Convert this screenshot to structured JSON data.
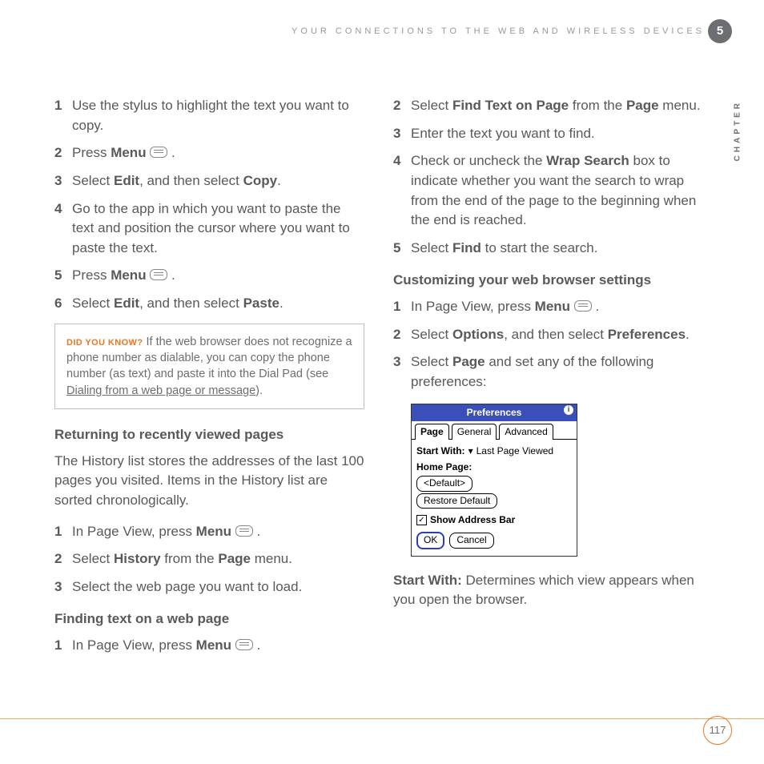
{
  "header": {
    "running_head": "YOUR CONNECTIONS TO THE WEB AND WIRELESS DEVICES",
    "chapter_number": "5",
    "chapter_label": "CHAPTER",
    "page_number": "117"
  },
  "left": {
    "steps_a": [
      {
        "n": "1",
        "pre": "Use the stylus to highlight the text you want to copy."
      },
      {
        "n": "2",
        "pre": "Press ",
        "bold": "Menu",
        "icon": true,
        "post": " ."
      },
      {
        "n": "3",
        "pre": "Select ",
        "bold": "Edit",
        "post": ", and then select ",
        "bold2": "Copy",
        "post2": "."
      },
      {
        "n": "4",
        "pre": "Go to the app in which you want to paste the text and position the cursor where you want to paste the text."
      },
      {
        "n": "5",
        "pre": "Press ",
        "bold": "Menu",
        "icon": true,
        "post": " ."
      },
      {
        "n": "6",
        "pre": "Select ",
        "bold": "Edit",
        "post": ", and then select ",
        "bold2": "Paste",
        "post2": "."
      }
    ],
    "tip": {
      "lead": "DID YOU KNOW?",
      "body_before": " If the web browser does not recognize a phone number as dialable, you can copy the phone number (as text) and paste it into the Dial Pad (see ",
      "link": "Dialing from a web page or message",
      "body_after": ")."
    },
    "heading_b": "Returning to recently viewed pages",
    "para_b": "The History list stores the addresses of the last 100 pages you visited. Items in the History list are sorted chronologically.",
    "steps_b": [
      {
        "n": "1",
        "pre": "In Page View, press ",
        "bold": "Menu",
        "icon": true,
        "post": " ."
      },
      {
        "n": "2",
        "pre": "Select ",
        "bold": "History",
        "post": " from the ",
        "bold2": "Page",
        "post2": " menu."
      },
      {
        "n": "3",
        "pre": "Select the web page you want to load."
      }
    ],
    "heading_c": "Finding text on a web page",
    "steps_c": [
      {
        "n": "1",
        "pre": "In Page View, press ",
        "bold": "Menu",
        "icon": true,
        "post": " ."
      }
    ]
  },
  "right": {
    "steps_a": [
      {
        "n": "2",
        "pre": "Select ",
        "bold": "Find Text on Page",
        "post": " from the ",
        "bold2": "Page",
        "post2": " menu."
      },
      {
        "n": "3",
        "pre": "Enter the text you want to find."
      },
      {
        "n": "4",
        "pre": "Check or uncheck the ",
        "bold": "Wrap Search",
        "post": " box to indicate whether you want the search to wrap from the end of the page to the beginning when the end is reached."
      },
      {
        "n": "5",
        "pre": "Select ",
        "bold": "Find",
        "post": " to start the search."
      }
    ],
    "heading_b": "Customizing your web browser settings",
    "steps_b": [
      {
        "n": "1",
        "pre": "In Page View, press ",
        "bold": "Menu",
        "icon": true,
        "post": " ."
      },
      {
        "n": "2",
        "pre": "Select ",
        "bold": "Options",
        "post": ", and then select ",
        "bold2": "Preferences",
        "post2": "."
      },
      {
        "n": "3",
        "pre": "Select ",
        "bold": "Page",
        "post": " and set any of the following preferences:"
      }
    ],
    "pref": {
      "title": "Preferences",
      "tabs": [
        "Page",
        "General",
        "Advanced"
      ],
      "start_with_label": "Start With:",
      "start_with_value": "Last Page Viewed",
      "home_page_label": "Home Page:",
      "home_page_value": "<Default>",
      "restore": "Restore Default",
      "show_addr": "Show Address Bar",
      "ok": "OK",
      "cancel": "Cancel"
    },
    "para_c_bold": "Start With:",
    "para_c_rest": " Determines which view appears when you open the browser."
  }
}
